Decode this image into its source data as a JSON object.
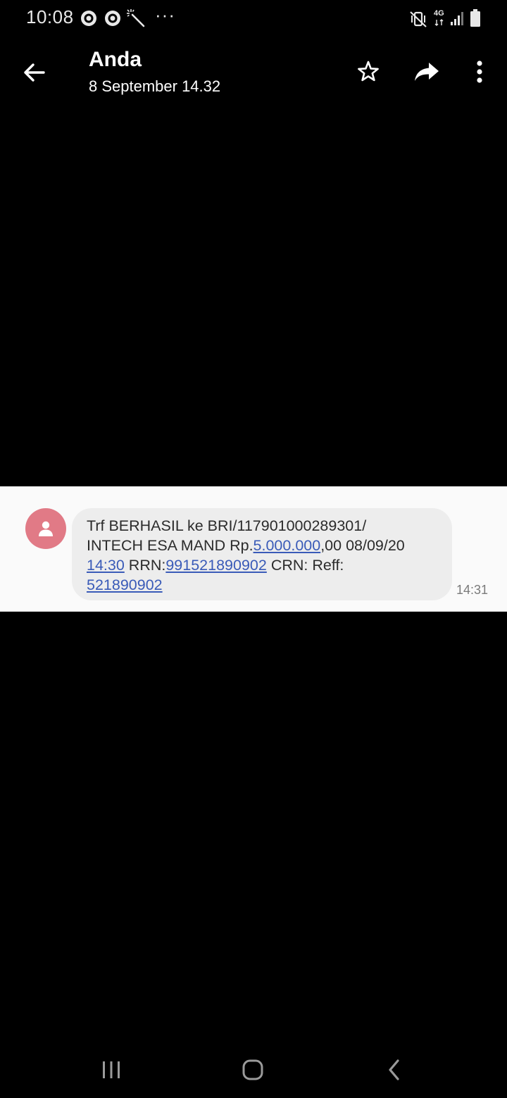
{
  "status_bar": {
    "time": "10:08",
    "more": "···",
    "network": "4G",
    "icons": [
      "target-icon",
      "target-icon",
      "magic-wand-icon",
      "vibrate-icon",
      "signal-icon",
      "battery-icon"
    ]
  },
  "header": {
    "back_icon": "arrow-left-icon",
    "title": "Anda",
    "subtitle": "8 September 14.32",
    "actions": [
      "star-icon",
      "forward-icon",
      "more-vert-icon"
    ]
  },
  "message": {
    "avatar_icon": "person-icon",
    "avatar_color": "#e17a86",
    "lines": [
      [
        {
          "text": "Trf BERHASIL ke BRI/117901000289301/",
          "link": false
        }
      ],
      [
        {
          "text": "INTECH ESA MAND Rp.",
          "link": false
        },
        {
          "text": "5.000.000",
          "link": true
        },
        {
          "text": ",00 08/09/20",
          "link": false
        }
      ],
      [
        {
          "text": "14:30",
          "link": true
        },
        {
          "text": " RRN:",
          "link": false
        },
        {
          "text": "991521890902",
          "link": true
        },
        {
          "text": " CRN: Reff:",
          "link": false
        }
      ],
      [
        {
          "text": "521890902",
          "link": true
        }
      ]
    ],
    "time": "14:31",
    "link_color": "#3a5bb8",
    "bubble_color": "#ededed"
  },
  "nav_bar": {
    "buttons": [
      "recents-icon",
      "home-icon",
      "back-icon"
    ]
  }
}
